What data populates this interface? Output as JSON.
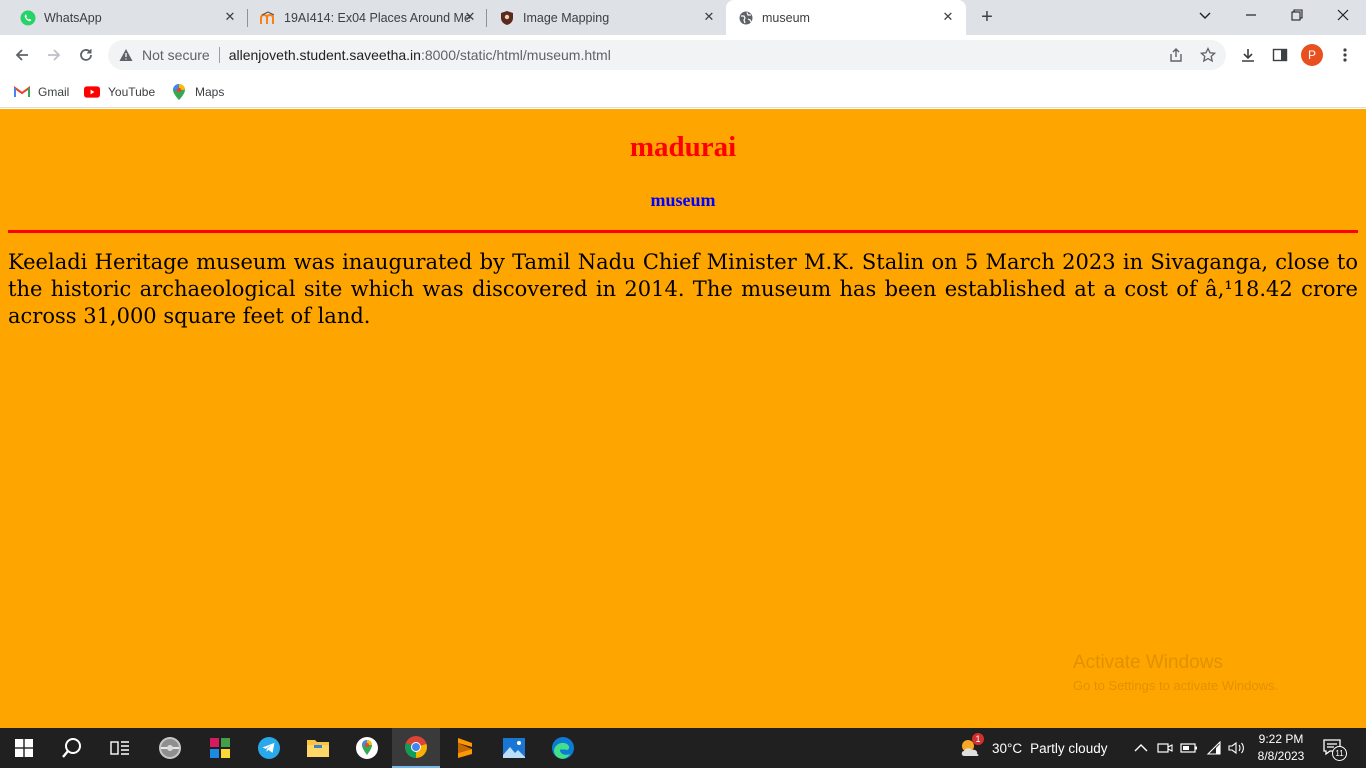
{
  "browser": {
    "tabs": [
      {
        "title": "WhatsApp",
        "icon": "whatsapp-icon",
        "active": false
      },
      {
        "title": "19AI414: Ex04 Places Around Me",
        "icon": "moodle-icon",
        "active": false
      },
      {
        "title": "Image Mapping",
        "icon": "shield-icon",
        "active": false
      },
      {
        "title": "museum",
        "icon": "globe-icon",
        "active": true
      }
    ],
    "security_label": "Not secure",
    "url_host": "allenjoveth.student.saveetha.in",
    "url_path": ":8000/static/html/museum.html",
    "profile_initial": "P",
    "bookmarks": [
      {
        "label": "Gmail",
        "icon": "gmail-icon"
      },
      {
        "label": "YouTube",
        "icon": "youtube-icon"
      },
      {
        "label": "Maps",
        "icon": "maps-icon"
      }
    ]
  },
  "page": {
    "background": "#ffa500",
    "title": "madurai",
    "title_color": "#ff0000",
    "subtitle": "museum",
    "subtitle_color": "#0000ff",
    "rule_color": "#ff0000",
    "paragraph": "Keeladi Heritage museum was inaugurated by Tamil Nadu Chief Minister M.K. Stalin on 5 March 2023 in Sivaganga, close to the historic archaeological site which was discovered in 2014. The museum has been established at a cost of â‚¹18.42 crore across 31,000 square feet of land."
  },
  "watermark": {
    "line1": "Activate Windows",
    "line2": "Go to Settings to activate Windows."
  },
  "taskbar": {
    "weather_badge": "1",
    "weather_temp": "30°C",
    "weather_desc": "Partly cloudy",
    "time": "9:22 PM",
    "date": "8/8/2023",
    "notification_count": "11"
  }
}
